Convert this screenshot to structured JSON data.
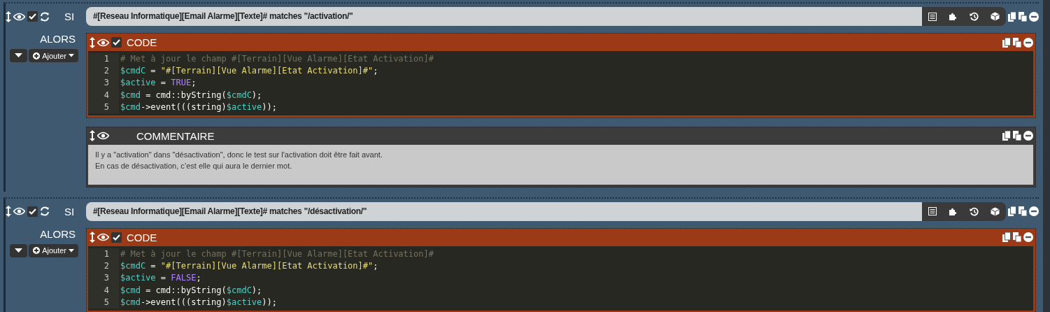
{
  "blocks": [
    {
      "condition_label": "SI",
      "condition": "#[Reseau Informatique][Email Alarme][Texte]# matches \"/activation/\"",
      "enabled": true,
      "then_label": "ALORS",
      "add_button": "Ajouter",
      "actions": [
        {
          "kind": "code",
          "title": "CODE",
          "enabled": true,
          "lines": [
            {
              "number": "1",
              "tokens": [
                {
                  "kind": "comment",
                  "text": "# Met à jour le champ #[Terrain][Vue Alarme][Etat Activation]#"
                }
              ]
            },
            {
              "number": "2",
              "tokens": [
                {
                  "kind": "var",
                  "text": "$cmdC"
                },
                {
                  "kind": "plain",
                  "text": " = "
                },
                {
                  "kind": "string",
                  "text": "\"#[Terrain][Vue Alarme][Etat Activation]#\""
                },
                {
                  "kind": "plain",
                  "text": ";"
                }
              ]
            },
            {
              "number": "3",
              "tokens": [
                {
                  "kind": "var",
                  "text": "$active"
                },
                {
                  "kind": "plain",
                  "text": " = "
                },
                {
                  "kind": "keyword",
                  "text": "TRUE"
                },
                {
                  "kind": "plain",
                  "text": ";"
                }
              ]
            },
            {
              "number": "4",
              "tokens": [
                {
                  "kind": "var",
                  "text": "$cmd"
                },
                {
                  "kind": "plain",
                  "text": " = cmd::byString("
                },
                {
                  "kind": "var",
                  "text": "$cmdC"
                },
                {
                  "kind": "plain",
                  "text": ");"
                }
              ]
            },
            {
              "number": "5",
              "tokens": [
                {
                  "kind": "var",
                  "text": "$cmd"
                },
                {
                  "kind": "plain",
                  "text": "->event(((string)"
                },
                {
                  "kind": "var",
                  "text": "$active"
                },
                {
                  "kind": "plain",
                  "text": "));"
                }
              ]
            }
          ]
        },
        {
          "kind": "comment",
          "title": "COMMENTAIRE",
          "text_lines": [
            "Il y a \"activation\" dans \"désactivation\", donc le test sur l'activation doit être fait avant.",
            "En cas de désactivation, c’est elle qui aura le dernier mot."
          ]
        }
      ]
    },
    {
      "condition_label": "SI",
      "condition": "#[Reseau Informatique][Email Alarme][Texte]# matches \"/désactivation/\"",
      "enabled": true,
      "then_label": "ALORS",
      "add_button": "Ajouter",
      "actions": [
        {
          "kind": "code",
          "title": "CODE",
          "enabled": true,
          "lines": [
            {
              "number": "1",
              "tokens": [
                {
                  "kind": "comment",
                  "text": "# Met à jour le champ #[Terrain][Vue Alarme][Etat Activation]#"
                }
              ]
            },
            {
              "number": "2",
              "tokens": [
                {
                  "kind": "var",
                  "text": "$cmdC"
                },
                {
                  "kind": "plain",
                  "text": " = "
                },
                {
                  "kind": "string",
                  "text": "\"#[Terrain][Vue Alarme][Etat Activation]#\""
                },
                {
                  "kind": "plain",
                  "text": ";"
                }
              ]
            },
            {
              "number": "3",
              "tokens": [
                {
                  "kind": "var",
                  "text": "$active"
                },
                {
                  "kind": "plain",
                  "text": " = "
                },
                {
                  "kind": "keyword",
                  "text": "FALSE"
                },
                {
                  "kind": "plain",
                  "text": ";"
                }
              ]
            },
            {
              "number": "4",
              "tokens": [
                {
                  "kind": "var",
                  "text": "$cmd"
                },
                {
                  "kind": "plain",
                  "text": " = cmd::byString("
                },
                {
                  "kind": "var",
                  "text": "$cmdC"
                },
                {
                  "kind": "plain",
                  "text": ");"
                }
              ]
            },
            {
              "number": "5",
              "tokens": [
                {
                  "kind": "var",
                  "text": "$cmd"
                },
                {
                  "kind": "plain",
                  "text": "->event(((string)"
                },
                {
                  "kind": "var",
                  "text": "$active"
                },
                {
                  "kind": "plain",
                  "text": "));"
                }
              ]
            }
          ]
        }
      ]
    }
  ]
}
